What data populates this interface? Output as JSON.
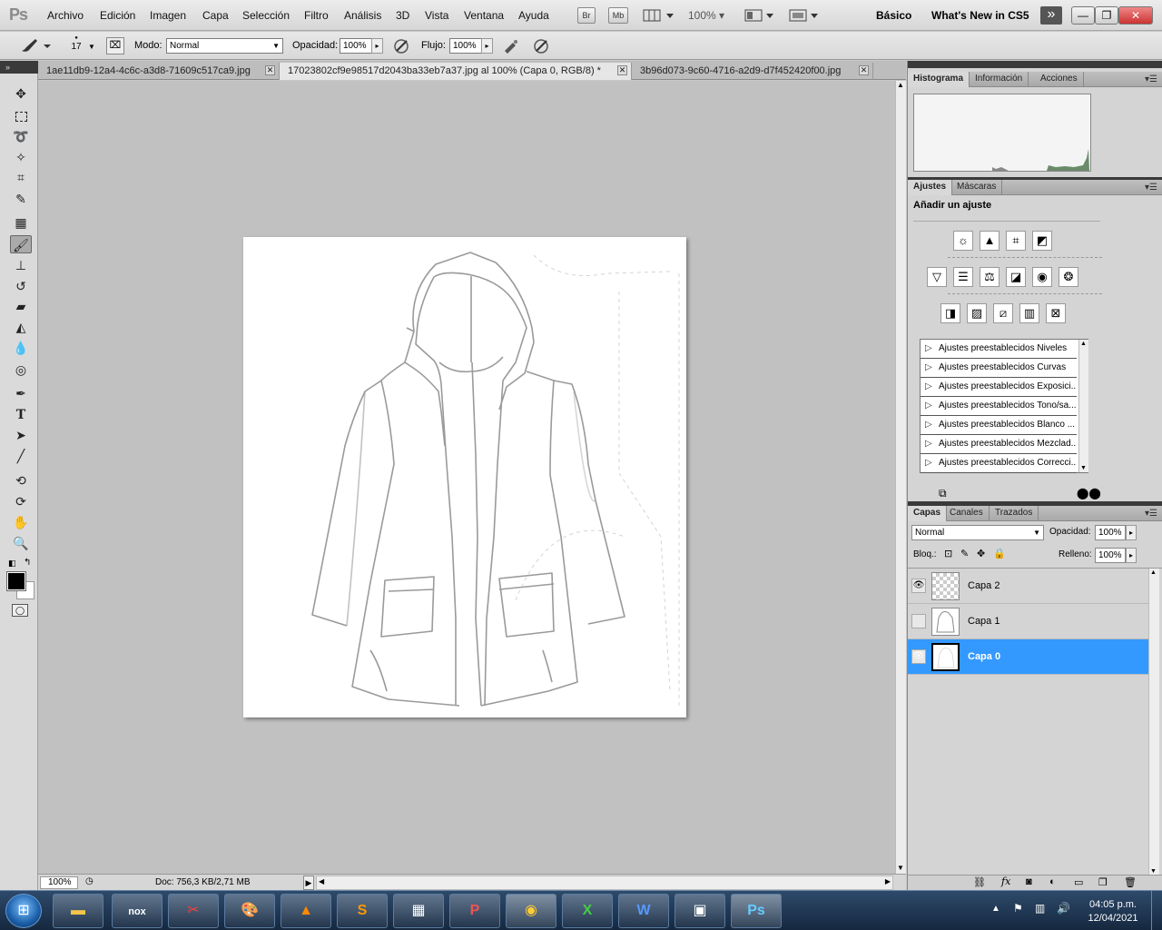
{
  "app": {
    "logo": "Ps"
  },
  "menu": [
    "Archivo",
    "Edición",
    "Imagen",
    "Capa",
    "Selección",
    "Filtro",
    "Análisis",
    "3D",
    "Vista",
    "Ventana",
    "Ayuda"
  ],
  "appbar": {
    "br": "Br",
    "mb": "Mb",
    "zoom": "100%",
    "workspace_basic": "Básico",
    "workspace_new": "What's New in CS5",
    "more": "»"
  },
  "window_controls": {
    "minimize": "—",
    "restore": "❐",
    "close": "✕"
  },
  "options": {
    "brush_size": "17",
    "mode_label": "Modo:",
    "mode_value": "Normal",
    "opacity_label": "Opacidad:",
    "opacity_value": "100%",
    "flow_label": "Flujo:",
    "flow_value": "100%"
  },
  "tabs": [
    {
      "title": "1ae11db9-12a4-4c6c-a3d8-71609c517ca9.jpg",
      "active": false
    },
    {
      "title": "17023802cf9e98517d2043ba33eb7a37.jpg al 100% (Capa 0, RGB/8) *",
      "active": true
    },
    {
      "title": "3b96d073-9c60-4716-a2d9-d7f452420f00.jpg",
      "active": false
    }
  ],
  "status": {
    "zoom": "100%",
    "doc": "Doc: 756,3 KB/2,71 MB"
  },
  "panels": {
    "top_tabs": [
      "Histograma",
      "Información",
      "Acciones"
    ],
    "adj_tabs": [
      "Ajustes",
      "Máscaras"
    ],
    "adj_title": "Añadir un ajuste",
    "presets": [
      "Ajustes preestablecidos Niveles",
      "Ajustes preestablecidos Curvas",
      "Ajustes preestablecidos Exposici...",
      "Ajustes preestablecidos Tono/sa...",
      "Ajustes preestablecidos Blanco ...",
      "Ajustes preestablecidos Mezclad...",
      "Ajustes preestablecidos Correcci..."
    ],
    "layer_tabs": [
      "Capas",
      "Canales",
      "Trazados"
    ],
    "blend_mode": "Normal",
    "opacity_label": "Opacidad:",
    "opacity_value": "100%",
    "lock_label": "Bloq.:",
    "fill_label": "Relleno:",
    "fill_value": "100%"
  },
  "layers": [
    {
      "name": "Capa 2",
      "visible": true,
      "selected": false
    },
    {
      "name": "Capa 1",
      "visible": false,
      "selected": false
    },
    {
      "name": "Capa 0",
      "visible": true,
      "selected": true
    }
  ],
  "taskbar": {
    "apps": [
      "nox",
      "paint",
      "palette",
      "vlc",
      "sublime",
      "calculator",
      "powerpoint",
      "chrome",
      "excel",
      "word",
      "photos",
      "photoshop"
    ],
    "clock_time": "04:05 p.m.",
    "clock_date": "12/04/2021"
  }
}
